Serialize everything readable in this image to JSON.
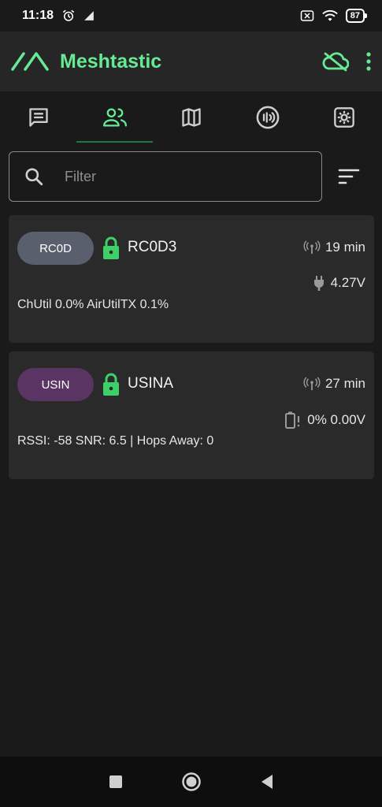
{
  "status_bar": {
    "time": "11:18",
    "battery": "87",
    "icons": [
      "alarm-icon",
      "signal-icon",
      "sim-off-icon",
      "wifi-icon",
      "battery-icon"
    ]
  },
  "app_bar": {
    "title": "Meshtastic",
    "accent_color": "#67ea94",
    "actions": [
      "cloud-off-icon",
      "overflow-menu-icon"
    ]
  },
  "tabs": [
    {
      "name": "messages",
      "icon": "chat-icon",
      "active": false
    },
    {
      "name": "nodes",
      "icon": "people-icon",
      "active": true
    },
    {
      "name": "map",
      "icon": "map-icon",
      "active": false
    },
    {
      "name": "channels",
      "icon": "radio-icon",
      "active": false
    },
    {
      "name": "settings",
      "icon": "settings-icon",
      "active": false
    }
  ],
  "filter": {
    "placeholder": "Filter",
    "value": ""
  },
  "nodes": [
    {
      "short_name": "RC0D",
      "long_name": "RC0D3",
      "chip_color": "#5a5f6e",
      "last_heard": "19 min",
      "power": "4.27V",
      "power_icon": "plug-icon",
      "info": "ChUtil 0.0% AirUtilTX 0.1%"
    },
    {
      "short_name": "USIN",
      "long_name": "USINA",
      "chip_color": "#5a3563",
      "last_heard": "27 min",
      "power": "0% 0.00V",
      "power_icon": "battery-alert-icon",
      "info": "RSSI: -58 SNR: 6.5 | Hops Away: 0"
    }
  ],
  "nav": [
    "recents-button",
    "home-button",
    "back-button"
  ]
}
